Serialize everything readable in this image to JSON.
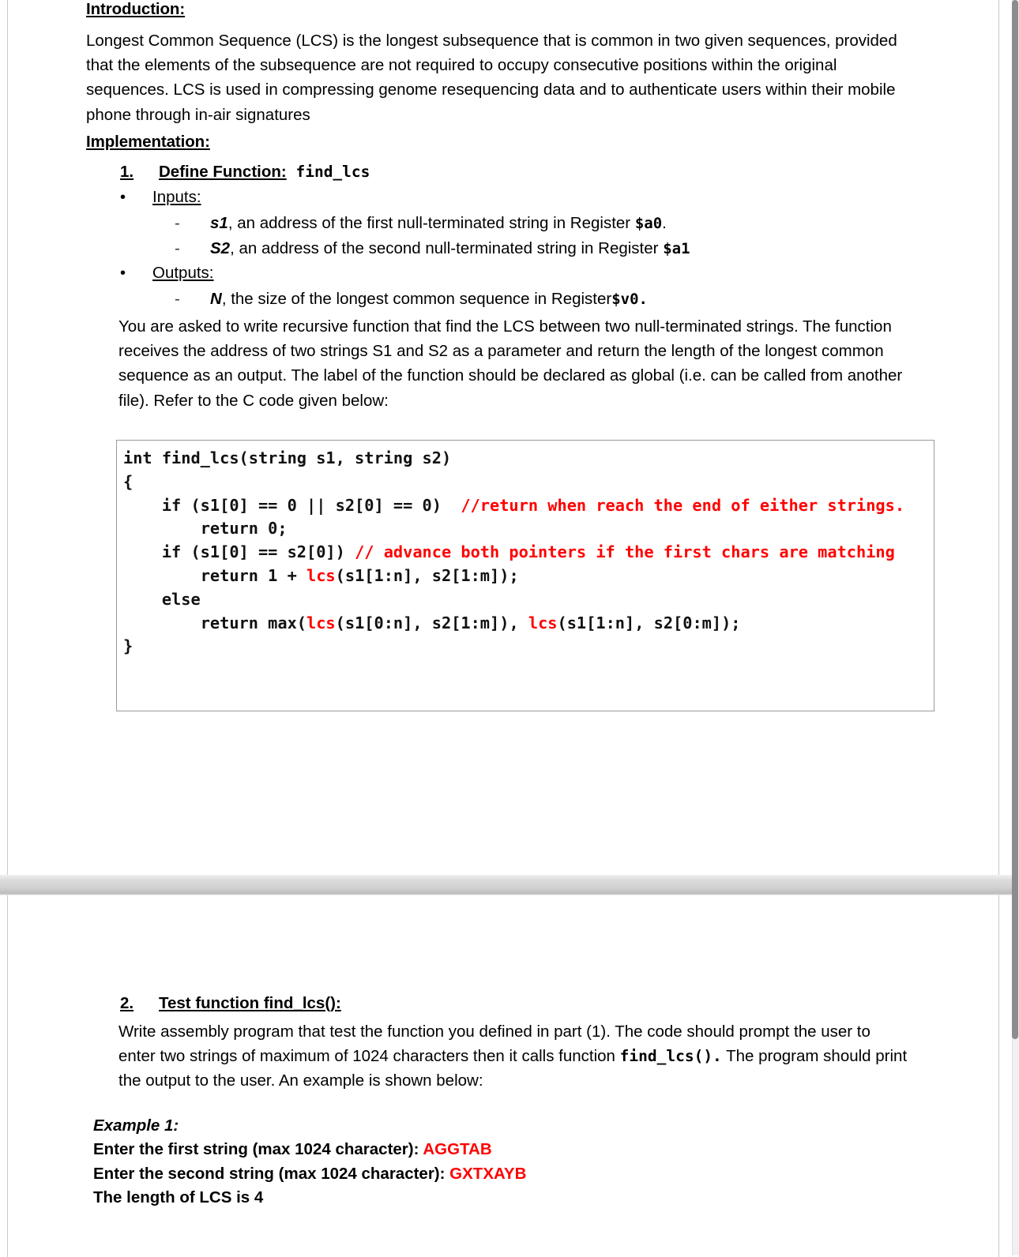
{
  "document": {
    "intro": {
      "heading": "Introduction:",
      "paragraph": "Longest Common Sequence (LCS) is the longest subsequence that is common in two given sequences, provided that the elements of the subsequence are not required to occupy consecutive positions within the original sequences. LCS is used in compressing genome resequencing data and to authenticate users within their mobile phone through in-air signatures"
    },
    "implementation": {
      "heading": "Implementation:",
      "item1": {
        "marker": "1.",
        "label": "Define Function:",
        "function_name": "find_lcs"
      },
      "inputs": {
        "bullet": "•",
        "label": "Inputs:",
        "entries": [
          {
            "marker": "-",
            "name": "s1",
            "text": ", an address of the first null-terminated string in Register ",
            "register": "$a0",
            "tail": "."
          },
          {
            "marker": "-",
            "name": "S2",
            "text": ", an address of the second null-terminated string in Register ",
            "register": "$a1",
            "tail": ""
          }
        ]
      },
      "outputs": {
        "bullet": "•",
        "label": "Outputs:",
        "entries": [
          {
            "marker": "-",
            "name": "N",
            "text": ", the size of the longest common sequence in Register",
            "register": "$v0.",
            "tail": ""
          }
        ]
      },
      "task_paragraph": "You are asked to write recursive function that find the LCS between two null-terminated strings. The function receives the address of two strings S1 and S2 as a parameter and return the length of the longest common sequence as an output. The label of the function should be declared  as global (i.e. can be called from another file). Refer to the C code given below:"
    },
    "code_block": {
      "language": "c",
      "comment_color": "#ff0000",
      "lines": [
        {
          "segments": [
            {
              "t": "int find_lcs(string s1, string s2)",
              "c": "code"
            }
          ]
        },
        {
          "segments": [
            {
              "t": "{",
              "c": "code"
            }
          ]
        },
        {
          "segments": [
            {
              "t": "    if (s1[0] == 0 || s2[0] == 0)  ",
              "c": "code"
            },
            {
              "t": "//return when reach the end of either strings.",
              "c": "comment"
            }
          ]
        },
        {
          "segments": [
            {
              "t": "        return 0;",
              "c": "code"
            }
          ]
        },
        {
          "segments": [
            {
              "t": "    if (s1[0] == s2[0]) ",
              "c": "code"
            },
            {
              "t": "// advance both pointers if the first chars are matching",
              "c": "comment"
            }
          ]
        },
        {
          "segments": [
            {
              "t": "        return 1 + ",
              "c": "code"
            },
            {
              "t": "lcs",
              "c": "fn"
            },
            {
              "t": "(s1[1:n], s2[1:m]);",
              "c": "code"
            }
          ]
        },
        {
          "segments": [
            {
              "t": "    else",
              "c": "code"
            }
          ]
        },
        {
          "segments": [
            {
              "t": "        return max(",
              "c": "code"
            },
            {
              "t": "lcs",
              "c": "fn"
            },
            {
              "t": "(s1[0:n], s2[1:m]), ",
              "c": "code"
            },
            {
              "t": "lcs",
              "c": "fn"
            },
            {
              "t": "(s1[1:n], s2[0:m]);",
              "c": "code"
            }
          ]
        },
        {
          "segments": [
            {
              "t": "}",
              "c": "code"
            }
          ]
        }
      ]
    },
    "test_section": {
      "marker": "2.",
      "heading": "Test function find_lcs():",
      "paragraph_part1": "Write assembly program that test the function you defined in part (1). The code should prompt the user to enter two strings of maximum of 1024 characters then it calls function ",
      "paragraph_mono": "find_lcs().",
      "paragraph_part2": " The program should print the output to the user. An example is shown below:",
      "example": {
        "title": "Example 1:",
        "lines": [
          {
            "prompt": "Enter the first string (max 1024 character): ",
            "value": "AGGTAB"
          },
          {
            "prompt": "Enter the second string (max 1024 character): ",
            "value": "GXTXAYB"
          }
        ],
        "result": "The length of LCS is 4"
      }
    }
  }
}
